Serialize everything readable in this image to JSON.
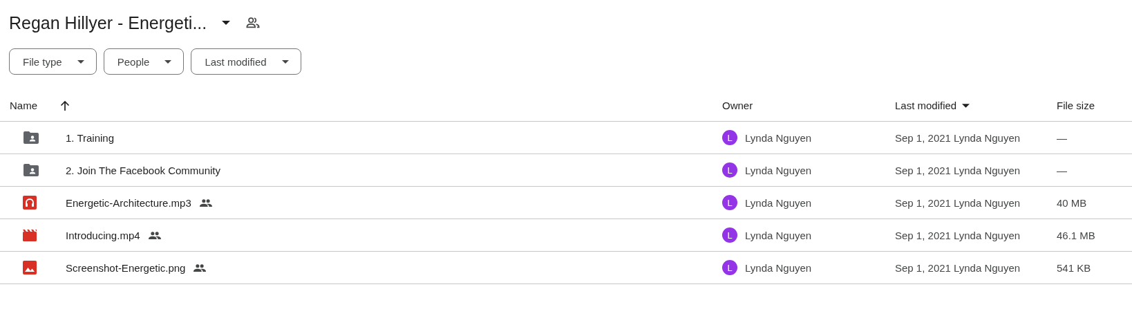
{
  "title": "Regan Hillyer - Energeti...",
  "filters": [
    "File type",
    "People",
    "Last modified"
  ],
  "columns": [
    {
      "label": "Name",
      "kind": "ascending"
    },
    {
      "label": "Owner",
      "kind": "plain"
    },
    {
      "label": "Last modified",
      "kind": "descending"
    },
    {
      "label": "File size",
      "kind": "plain"
    }
  ],
  "rows": [
    {
      "kind": "shared-folder",
      "name": "1. Training",
      "shared": false,
      "owner_initial": "L",
      "color": "#9334e6",
      "owner": "Lynda Nguyen",
      "modified": "Sep 1, 2021",
      "modified_by": "Lynda Nguyen",
      "size": "—"
    },
    {
      "kind": "shared-folder",
      "name": "2. Join The Facebook Community",
      "shared": false,
      "owner_initial": "L",
      "color": "#9334e6",
      "owner": "Lynda Nguyen",
      "modified": "Sep 1, 2021",
      "modified_by": "Lynda Nguyen",
      "size": "—"
    },
    {
      "kind": "audio",
      "name": "Energetic-Architecture.mp3",
      "shared": true,
      "owner_initial": "L",
      "color": "#9334e6",
      "owner": "Lynda Nguyen",
      "modified": "Sep 1, 2021",
      "modified_by": "Lynda Nguyen",
      "size": "40 MB"
    },
    {
      "kind": "video",
      "name": "Introducing.mp4",
      "shared": true,
      "owner_initial": "L",
      "color": "#9334e6",
      "owner": "Lynda Nguyen",
      "modified": "Sep 1, 2021",
      "modified_by": "Lynda Nguyen",
      "size": "46.1 MB"
    },
    {
      "kind": "image",
      "name": "Screenshot-Energetic.png",
      "shared": true,
      "owner_initial": "L",
      "color": "#9334e6",
      "owner": "Lynda Nguyen",
      "modified": "Sep 1, 2021",
      "modified_by": "Lynda Nguyen",
      "size": "541 KB"
    }
  ]
}
